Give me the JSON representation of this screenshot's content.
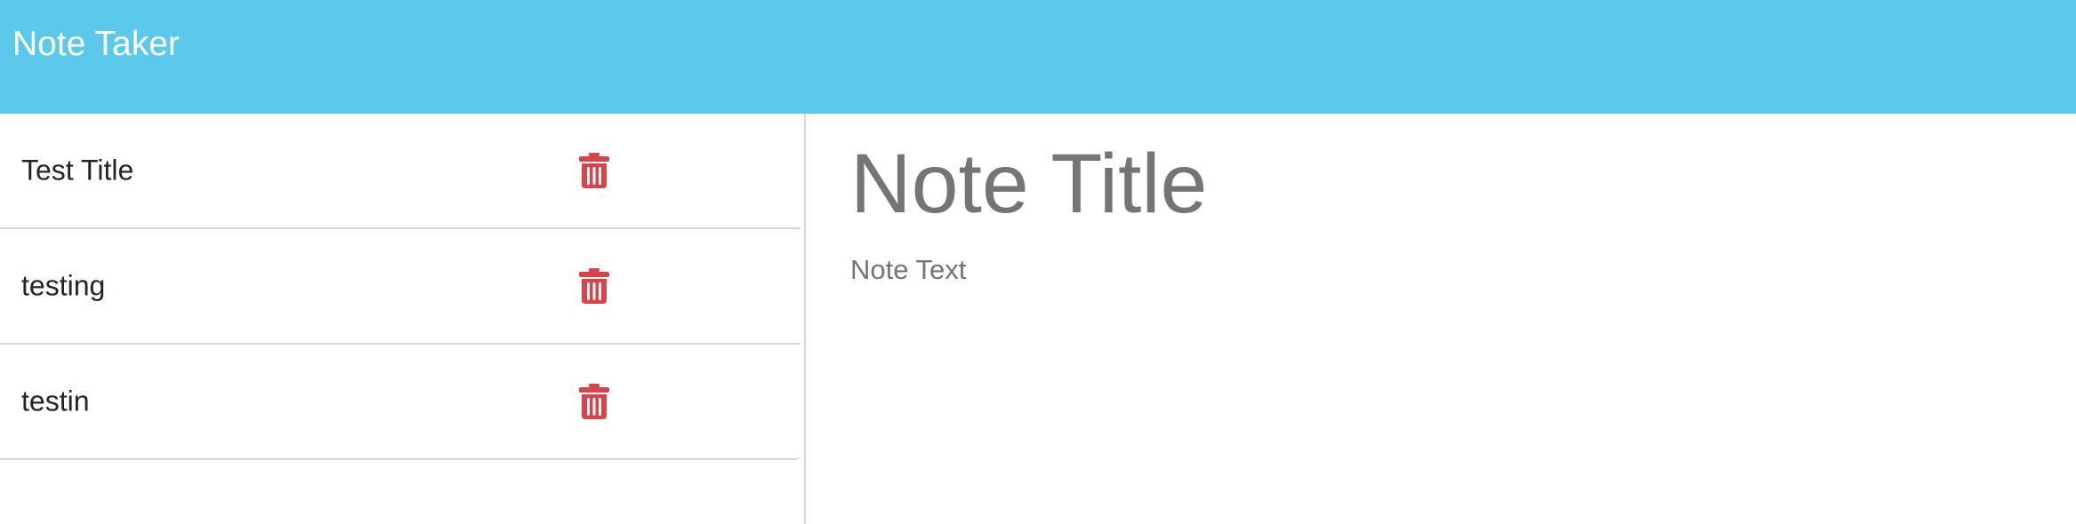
{
  "navbar": {
    "brand": "Note Taker",
    "background_color": "#5bc8ec"
  },
  "notes": [
    {
      "title": "Test Title",
      "delete_icon": "trash-icon"
    },
    {
      "title": "testing",
      "delete_icon": "trash-icon"
    },
    {
      "title": "testin",
      "delete_icon": "trash-icon"
    }
  ],
  "editor": {
    "title_placeholder": "Note Title",
    "text_placeholder": "Note Text"
  },
  "colors": {
    "delete_icon": "#d9434a",
    "placeholder_text": "#757575"
  }
}
